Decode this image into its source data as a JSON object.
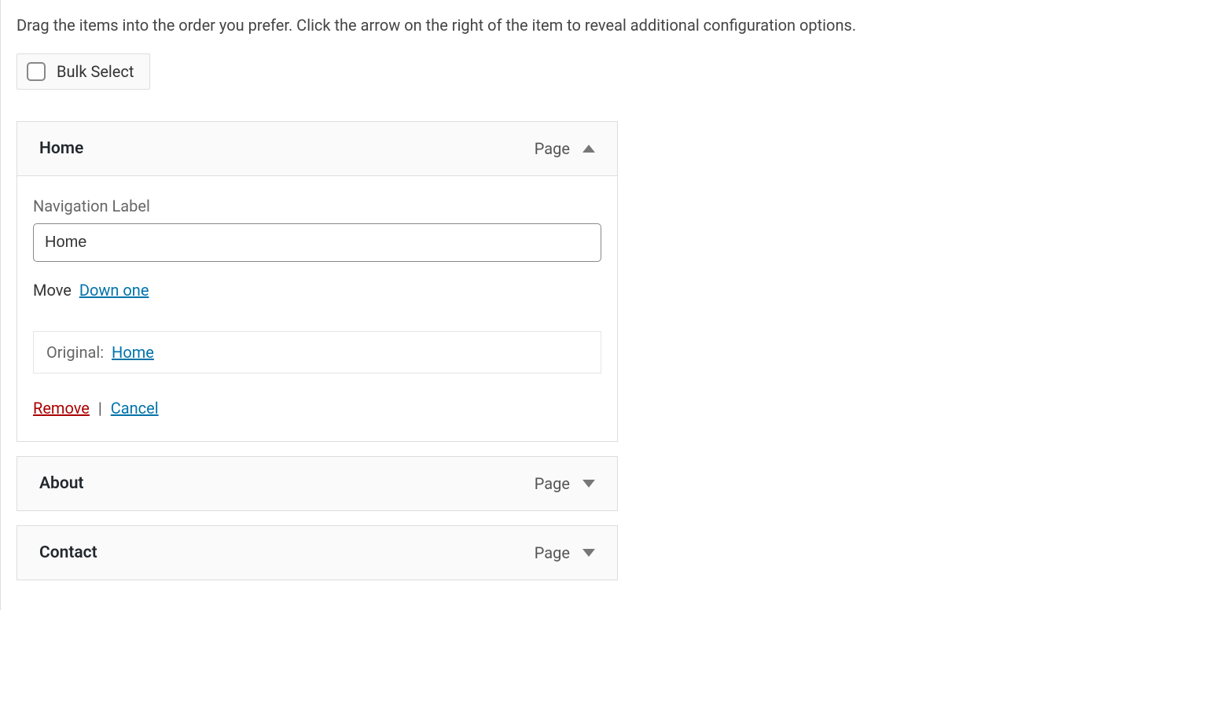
{
  "instructions": "Drag the items into the order you prefer. Click the arrow on the right of the item to reveal additional configuration options.",
  "bulkSelect": {
    "label": "Bulk Select"
  },
  "menuItems": [
    {
      "title": "Home",
      "type": "Page",
      "expanded": true,
      "navLabel": "Navigation Label",
      "navValue": "Home",
      "moveLabel": "Move",
      "moveDown": "Down one",
      "originalLabel": "Original:",
      "originalLink": "Home",
      "removeLabel": "Remove",
      "cancelLabel": "Cancel"
    },
    {
      "title": "About",
      "type": "Page",
      "expanded": false
    },
    {
      "title": "Contact",
      "type": "Page",
      "expanded": false
    }
  ]
}
